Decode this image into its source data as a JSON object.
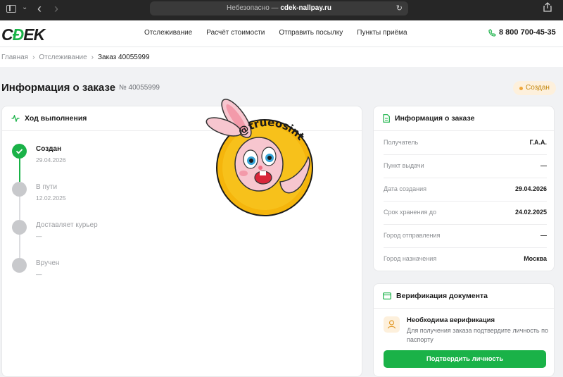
{
  "browser": {
    "address_prefix": "Небезопасно —",
    "address_domain": "cdek-nallpay.ru"
  },
  "header": {
    "logo_text_a": "C",
    "logo_text_b": "Ð",
    "logo_text_c": "EK",
    "nav": [
      "Отслеживание",
      "Расчёт стоимости",
      "Отправить посылку",
      "Пункты приёма"
    ],
    "phone": "8 800 700-45-35"
  },
  "breadcrumb": {
    "items": [
      "Главная",
      "Отслеживание"
    ],
    "current": "Заказ 40055999",
    "separator": "›"
  },
  "page": {
    "title": "Информация о заказе",
    "order_no": "№ 40055999",
    "status": "Создан"
  },
  "progress": {
    "title": "Ход выполнения",
    "steps": [
      {
        "title": "Создан",
        "date": "29.04.2026",
        "done": true
      },
      {
        "title": "В пути",
        "date": "12.02.2025",
        "done": false
      },
      {
        "title": "Доставляет курьер",
        "date": "—",
        "done": false
      },
      {
        "title": "Вручен",
        "date": "—",
        "done": false
      }
    ]
  },
  "watermark": {
    "handle": "@trueosint"
  },
  "order_info": {
    "title": "Информация о заказе",
    "rows": [
      {
        "k": "Получатель",
        "v": "Г.А.А."
      },
      {
        "k": "Пункт выдачи",
        "v": "—"
      },
      {
        "k": "Дата создания",
        "v": "29.04.2026"
      },
      {
        "k": "Срок хранения до",
        "v": "24.02.2025"
      },
      {
        "k": "Город отправления",
        "v": "—"
      },
      {
        "k": "Город назначения",
        "v": "Москва"
      }
    ]
  },
  "verification": {
    "title": "Верификация документа",
    "notice_title": "Необходима верификация",
    "notice_text": "Для получения заказа подтвердите личность по паспорту",
    "button": "Подтвердить личность"
  },
  "colors": {
    "brand_green": "#1ab248",
    "status_bg": "#fdf0dc",
    "status_text": "#c4880f"
  }
}
